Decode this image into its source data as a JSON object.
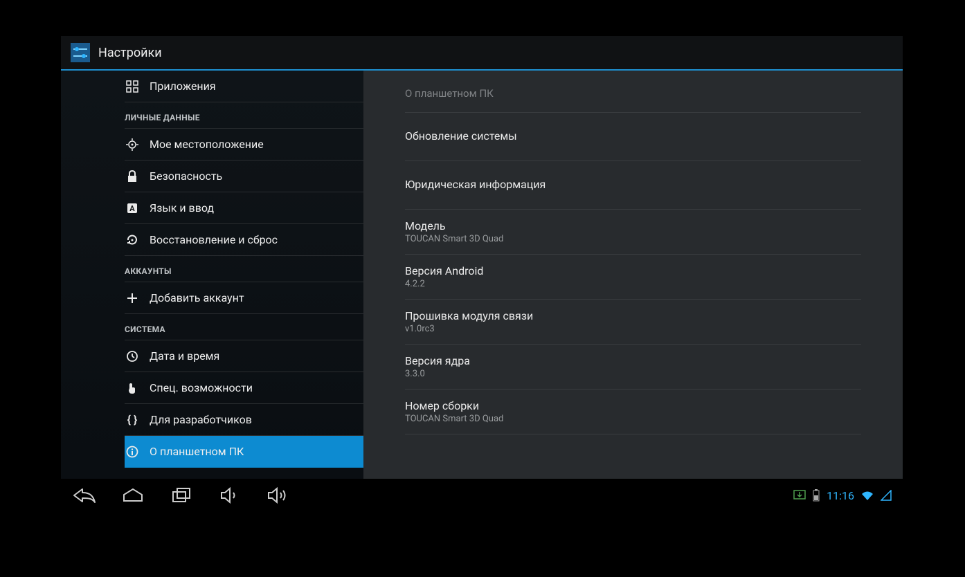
{
  "header": {
    "title": "Настройки"
  },
  "sidebar": {
    "items": [
      {
        "label": "Приложения",
        "icon": "apps"
      },
      {
        "head": "ЛИЧНЫЕ ДАННЫЕ"
      },
      {
        "label": "Мое местоположение",
        "icon": "location"
      },
      {
        "label": "Безопасность",
        "icon": "lock"
      },
      {
        "label": "Язык и ввод",
        "icon": "language"
      },
      {
        "label": "Восстановление и сброс",
        "icon": "reset"
      },
      {
        "head": "АККАУНТЫ"
      },
      {
        "label": "Добавить аккаунт",
        "icon": "plus"
      },
      {
        "head": "СИСТЕМА"
      },
      {
        "label": "Дата и время",
        "icon": "clock"
      },
      {
        "label": "Спец. возможности",
        "icon": "hand"
      },
      {
        "label": "Для разработчиков",
        "icon": "braces"
      },
      {
        "label": "О планшетном ПК",
        "icon": "info",
        "selected": true
      }
    ]
  },
  "detail": {
    "title": "О планшетном ПК",
    "rows": [
      {
        "title": "Обновление системы",
        "tall": true
      },
      {
        "title": "Юридическая информация",
        "tall": true
      },
      {
        "title": "Модель",
        "sub": "TOUCAN Smart 3D Quad"
      },
      {
        "title": "Версия Android",
        "sub": "4.2.2"
      },
      {
        "title": "Прошивка модуля связи",
        "sub": "v1.0rc3"
      },
      {
        "title": "Версия ядра",
        "sub": "3.3.0"
      },
      {
        "title": "Номер сборки",
        "sub": "TOUCAN Smart 3D Quad"
      }
    ]
  },
  "statusbar": {
    "time": "11:16"
  }
}
